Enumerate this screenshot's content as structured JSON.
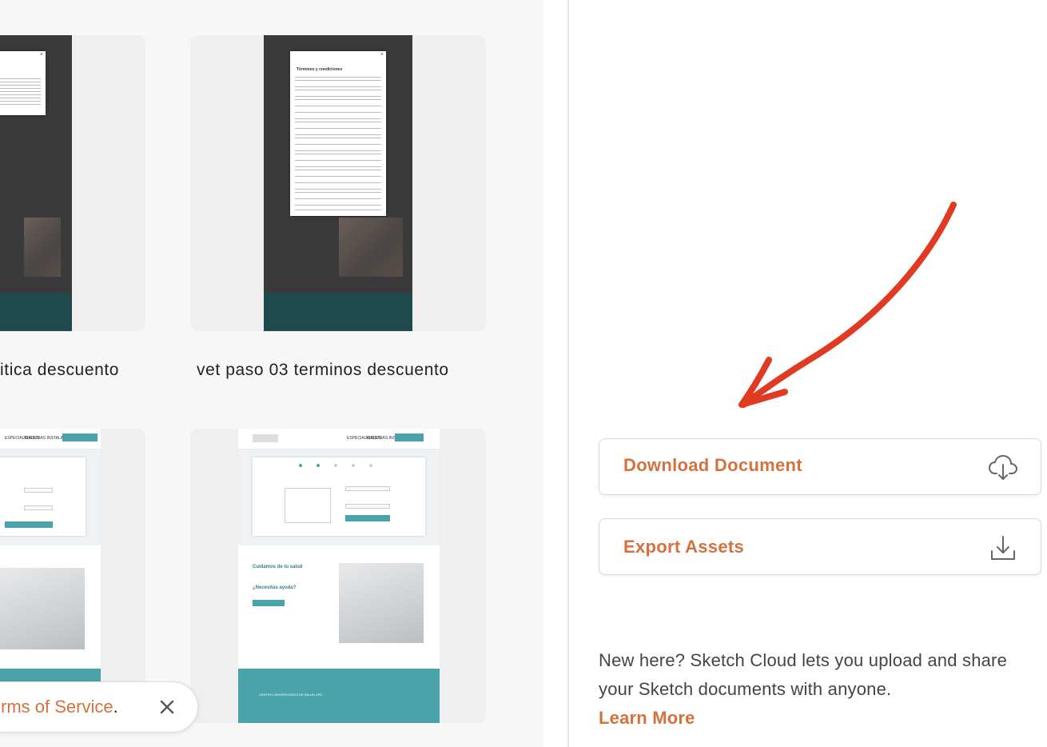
{
  "gallery": {
    "cards": [
      {
        "label": "itica descuento"
      },
      {
        "label": "vet paso 03 terminos descuento"
      },
      {
        "label": ""
      },
      {
        "label": ""
      }
    ],
    "thumbnail_texts": {
      "modal_title": "Términos y condiciones",
      "nav_specialties": "ESPECIALIDADES",
      "nav_facilities": "NUESTRAS INSTALACIONES",
      "health_heading": "Cuidamos de tu salud",
      "help_heading": "¿Necesitas ayuda?",
      "footer_brand": "CENTRO UNIVERSITARIO DE SALUD UPC"
    }
  },
  "cookie_toast": {
    "link_text": "rms of Service",
    "suffix": "."
  },
  "sidebar": {
    "download_label": "Download Document",
    "export_label": "Export Assets",
    "promo_text": "New here? Sketch Cloud lets you upload and share your Sketch documents with anyone.",
    "learn_more": "Learn More"
  },
  "colors": {
    "accent": "#d4713e",
    "arrow": "#e03a22",
    "teal": "#4aa3a8"
  },
  "icons": {
    "download": "cloud-download-icon",
    "export": "tray-download-icon",
    "close": "close-icon"
  }
}
